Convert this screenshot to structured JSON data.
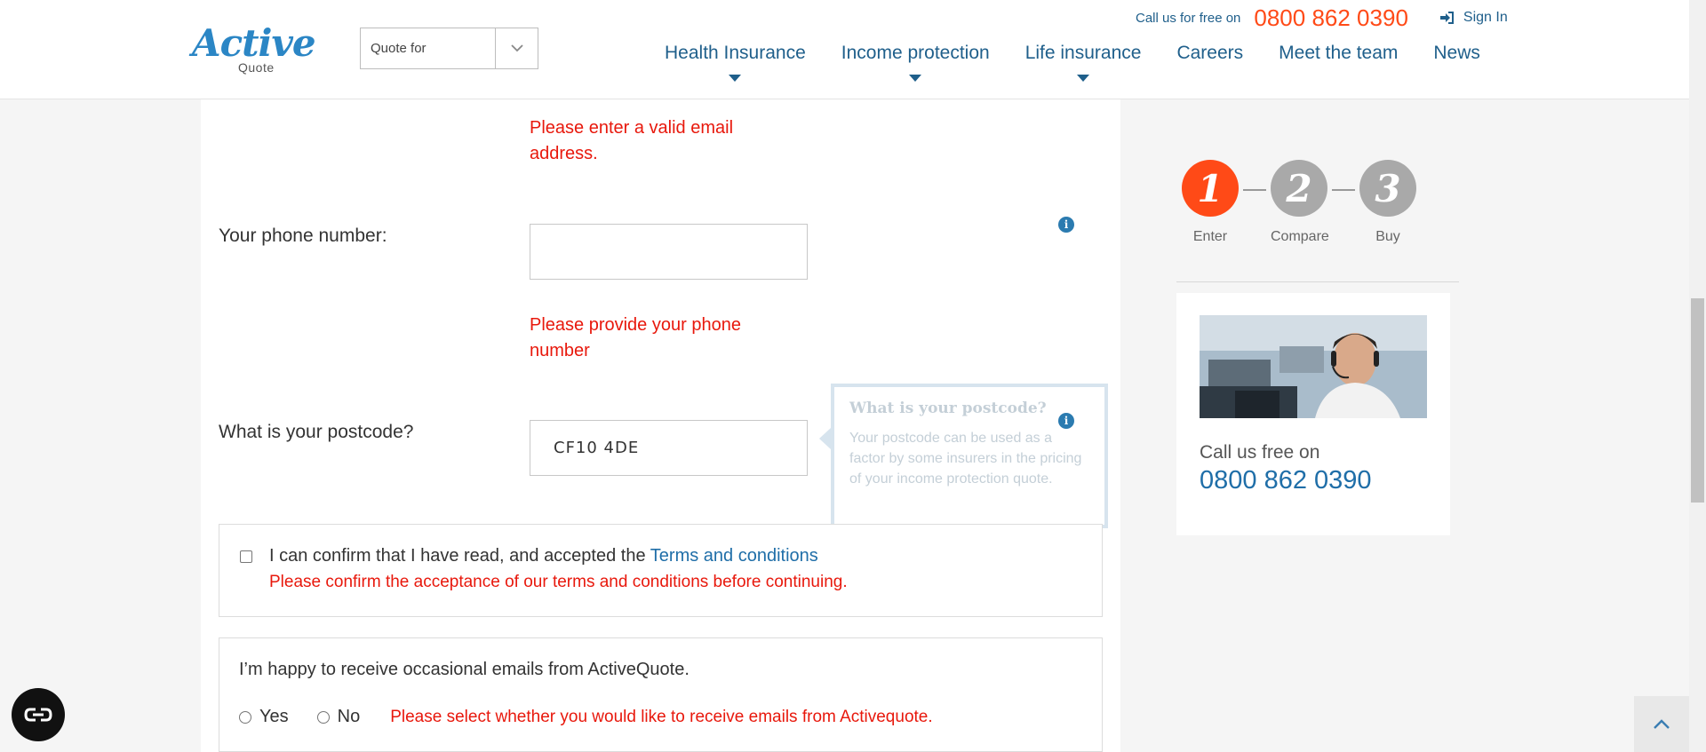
{
  "header": {
    "logo_main": "Active",
    "logo_sub": "Quote",
    "quote_select": {
      "selected": "Quote for"
    },
    "call_label": "Call us for free on",
    "phone": "0800 862 0390",
    "sign_in": "Sign In",
    "nav": [
      {
        "label": "Health Insurance",
        "has_dropdown": true
      },
      {
        "label": "Income protection",
        "has_dropdown": true
      },
      {
        "label": "Life insurance",
        "has_dropdown": true
      },
      {
        "label": "Careers",
        "has_dropdown": false
      },
      {
        "label": "Meet the team",
        "has_dropdown": false
      },
      {
        "label": "News",
        "has_dropdown": false
      }
    ]
  },
  "form": {
    "email_error": "Please enter a valid email address.",
    "phone": {
      "label": "Your phone number:",
      "value": "",
      "error": "Please provide your phone number"
    },
    "postcode": {
      "label": "What is your postcode?",
      "value": "CF10 4DE"
    },
    "tooltip": {
      "title": "What is your postcode?",
      "body": "Your postcode can be used as a factor by some insurers in the pricing of your income protection quote."
    },
    "terms": {
      "text": "I can confirm that I have read, and accepted the",
      "link": "Terms and conditions",
      "error": "Please confirm the acceptance of our terms and conditions before continuing.",
      "checked": false
    },
    "marketing": {
      "question": "I’m happy to receive occasional emails from ActiveQuote.",
      "yes_label": "Yes",
      "no_label": "No",
      "error": "Please select whether you would like to receive emails from Activequote."
    }
  },
  "sidebar": {
    "steps": [
      {
        "number": "1",
        "label": "Enter",
        "active": true
      },
      {
        "number": "2",
        "label": "Compare",
        "active": false
      },
      {
        "number": "3",
        "label": "Buy",
        "active": false
      }
    ],
    "call_label": "Call us free on",
    "phone": "0800 862 0390"
  },
  "colors": {
    "brand_blue": "#1f5f8b",
    "accent_orange": "#ff4a17",
    "error_red": "#e8180c",
    "step_inactive": "#a9a9a9"
  }
}
